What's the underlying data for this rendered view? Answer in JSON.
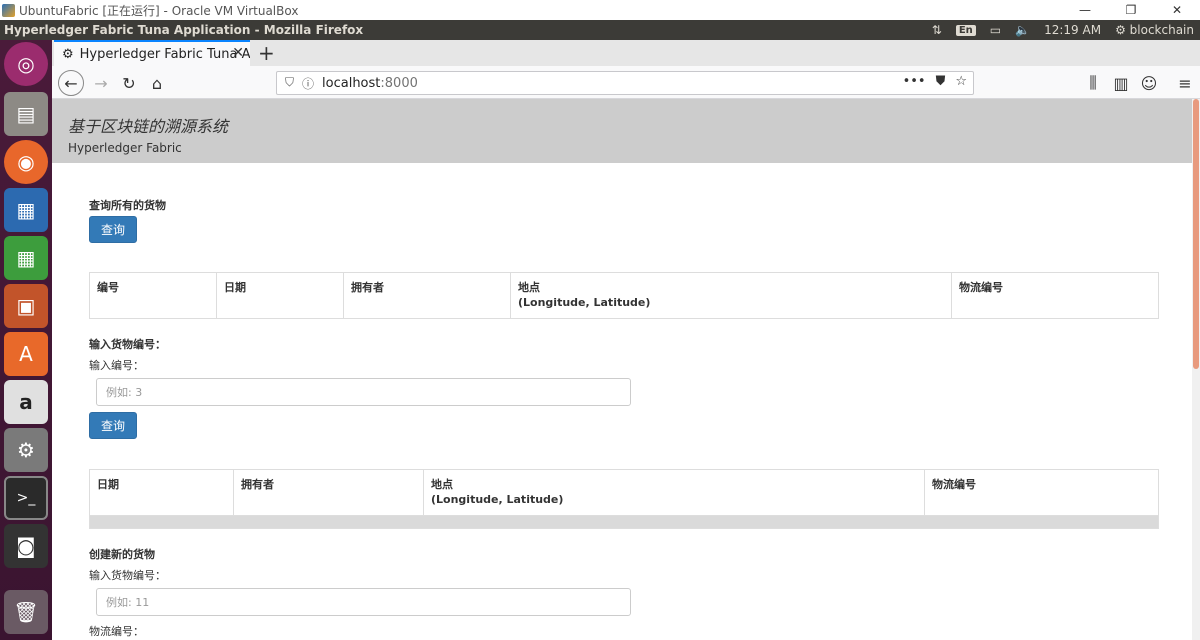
{
  "host_window": {
    "title": "UbuntuFabric [正在运行] - Oracle VM VirtualBox"
  },
  "ubuntu_panel": {
    "app_title": "Hyperledger Fabric Tuna Application - Mozilla Firefox",
    "keyboard": "En",
    "clock": "12:19 AM",
    "user": "blockchain"
  },
  "browser": {
    "tab_title": "Hyperledger Fabric Tuna Application",
    "url_host": "localhost",
    "url_port": ":8000"
  },
  "header": {
    "title": "基于区块链的溯源系统",
    "subtitle": "Hyperledger Fabric"
  },
  "query_all": {
    "label": "查询所有的货物",
    "button": "查询",
    "columns": [
      "编号",
      "日期",
      "拥有者",
      "地点",
      "物流编号"
    ],
    "location_sub": "(Longitude, Latitude)"
  },
  "query_one": {
    "label": "输入货物编号：",
    "field_label": "输入编号：",
    "placeholder": "例如: 3",
    "button": "查询",
    "columns": [
      "日期",
      "拥有者",
      "地点",
      "物流编号"
    ],
    "location_sub": "(Longitude, Latitude)"
  },
  "create": {
    "label": "创建新的货物",
    "id_label": "输入货物编号：",
    "id_placeholder": "例如: 11",
    "logistics_label": "物流编号："
  }
}
